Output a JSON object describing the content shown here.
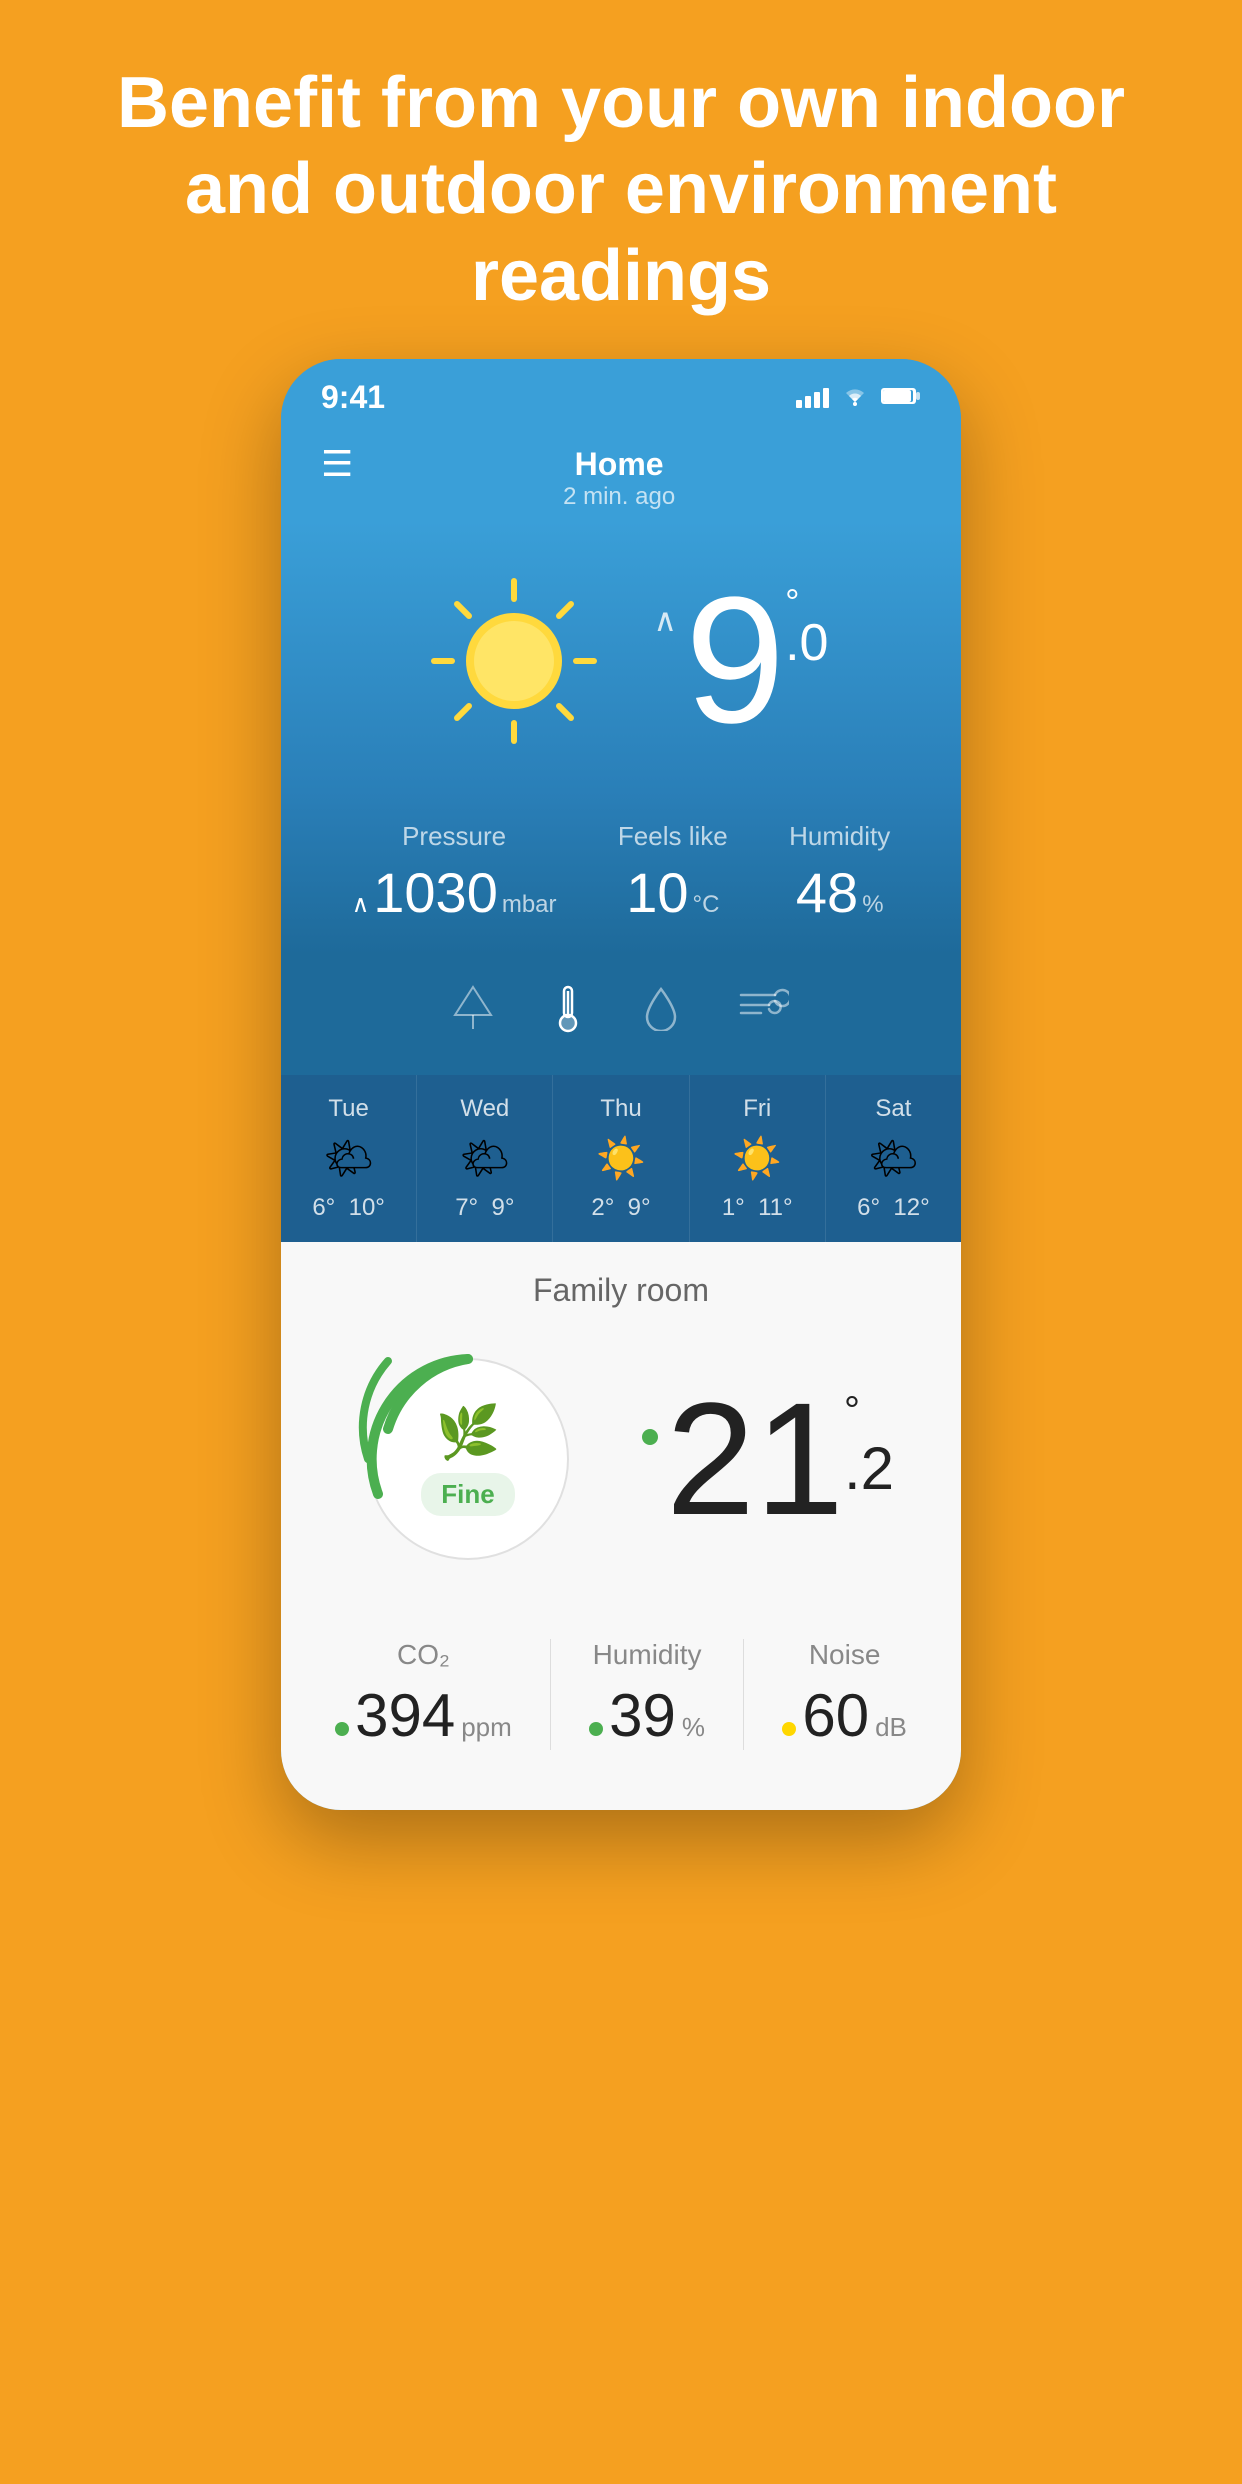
{
  "header": {
    "title": "Benefit from your own indoor and outdoor environment readings"
  },
  "status_bar": {
    "time": "9:41"
  },
  "nav": {
    "location": "Home",
    "updated": "2 min. ago"
  },
  "weather": {
    "temperature": "9",
    "temp_decimal": ".0",
    "pressure_label": "Pressure",
    "pressure_value": "1030",
    "pressure_unit": "mbar",
    "feels_like_label": "Feels like",
    "feels_like_value": "10",
    "feels_like_unit": "°C",
    "humidity_label": "Humidity",
    "humidity_value": "48",
    "humidity_unit": "%"
  },
  "forecast": [
    {
      "day": "Tue",
      "icon": "🌤",
      "low": "6°",
      "high": "10°"
    },
    {
      "day": "Wed",
      "icon": "🌤",
      "low": "7°",
      "high": "9°"
    },
    {
      "day": "Thu",
      "icon": "☀️",
      "low": "2°",
      "high": "9°"
    },
    {
      "day": "Fri",
      "icon": "☀️",
      "low": "1°",
      "high": "11°"
    },
    {
      "day": "Sat",
      "icon": "🌤",
      "low": "6°",
      "high": "12°"
    }
  ],
  "indoor": {
    "room": "Family room",
    "air_quality_status": "Fine",
    "temperature": "21",
    "temp_decimal": ".2",
    "co2_label": "CO₂",
    "co2_value": "394",
    "co2_unit": "ppm",
    "humidity_label": "Humidity",
    "humidity_value": "39",
    "humidity_unit": "%",
    "noise_label": "Noise",
    "noise_value": "60",
    "noise_unit": "dB"
  },
  "icons": {
    "menu": "☰",
    "tree": "△",
    "thermometer": "🌡",
    "drop": "💧",
    "wind": "≋"
  }
}
